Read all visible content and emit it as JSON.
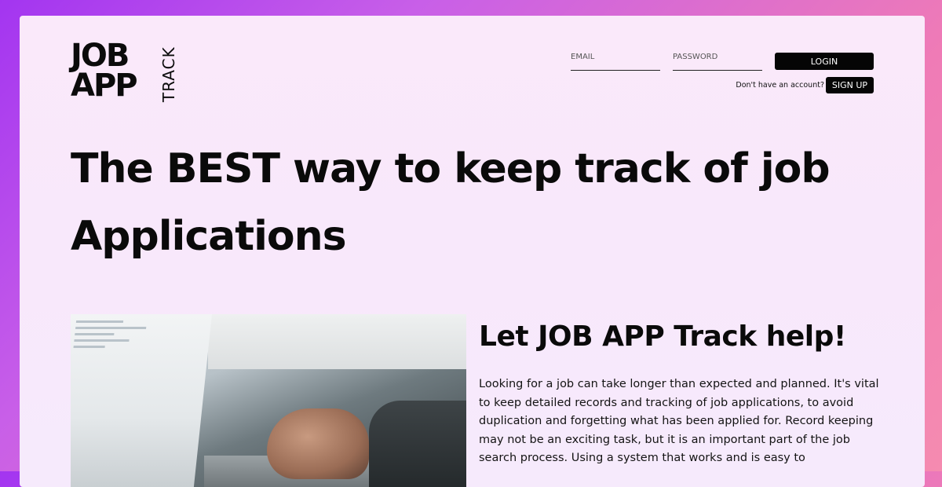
{
  "logo": {
    "line1": "JOB",
    "line2": "APP",
    "vertical": "TRACK"
  },
  "auth": {
    "email_placeholder": "EMAIL",
    "password_placeholder": "PASSWORD",
    "login_label": "LOGIN",
    "no_account_text": "Don't have an account?",
    "signup_label": "SIGN UP"
  },
  "hero": {
    "line1": "The BEST way to keep track of job",
    "line2": "Applications"
  },
  "section": {
    "heading": "Let JOB APP Track help!",
    "paragraph": "Looking for a job can take longer than expected and planned. It's vital to keep detailed records and tracking of job applications, to avoid duplication and forgetting what has been applied for. Record keeping may not be an exciting task, but it is an important part of the job search process. Using a system that works and is easy to"
  },
  "colors": {
    "accent": "#050505",
    "background_gradient_start": "#a335f0",
    "background_gradient_end": "#f58bb0",
    "card": "#f8e8fb"
  },
  "icons": []
}
